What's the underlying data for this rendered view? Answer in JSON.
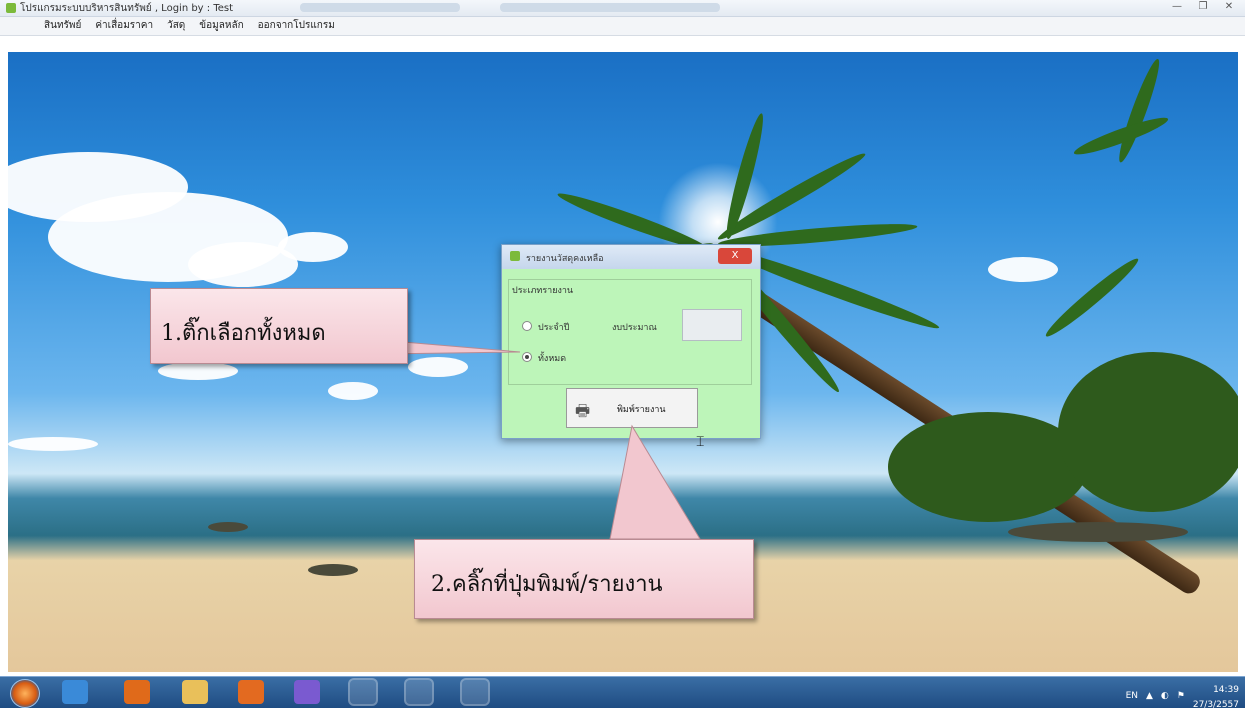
{
  "window": {
    "title": "โปรแกรมระบบบริหารสินทรัพย์ , Login by : Test"
  },
  "menubar": {
    "items": [
      "สินทรัพย์",
      "ค่าเสื่อมราคา",
      "วัสดุ",
      "ข้อมูลหลัก",
      "ออกจากโปรแกรม"
    ]
  },
  "dialog": {
    "title": "รายงานวัสดุคงเหลือ",
    "close_label": "X",
    "group_label": "ประเภทรายงาน",
    "option_year_label": "ประจำปี",
    "year_field_label": "งบประมาณ",
    "year_value": "",
    "option_all_label": "ทั้งหมด",
    "selected_option": "all",
    "print_button_label": "พิมพ์รายงาน"
  },
  "callouts": {
    "step1": "1.ติ๊กเลือกทั้งหมด",
    "step2": "2.คลิ๊กที่ปุ่มพิมพ์/รายงาน"
  },
  "taskbar": {
    "apps": [
      "internet-explorer-icon",
      "media-player-icon",
      "file-explorer-icon",
      "firefox-icon",
      "messenger-icon",
      "skype-icon",
      "word-icon",
      "app-n-icon"
    ],
    "language": "EN",
    "time": "14:39",
    "date": "27/3/2557"
  },
  "colors": {
    "dialog_bg": "#bdf5b9",
    "callout_bg": "#f2c7cf",
    "close_button": "#d9473a",
    "taskbar": "#1f4c82"
  }
}
